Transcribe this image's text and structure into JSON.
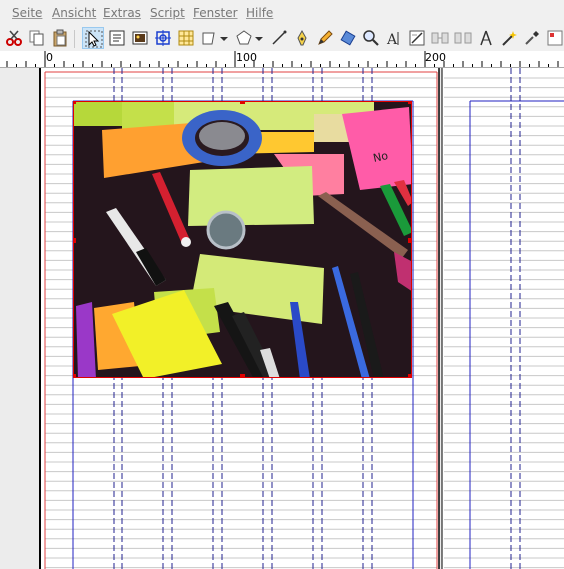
{
  "menu": {
    "items": [
      {
        "label": "Seite"
      },
      {
        "label": "Ansicht"
      },
      {
        "label": "Extras"
      },
      {
        "label": "Script"
      },
      {
        "label": "Fenster"
      },
      {
        "label": "Hilfe"
      }
    ]
  },
  "ruler": {
    "labels": [
      "0",
      "100",
      "200"
    ]
  },
  "colors": {
    "selection": "#e00000",
    "margin_guide": "#2020c0",
    "baseline_grid": "#c8c8c8",
    "column_guide": "#20208f"
  }
}
